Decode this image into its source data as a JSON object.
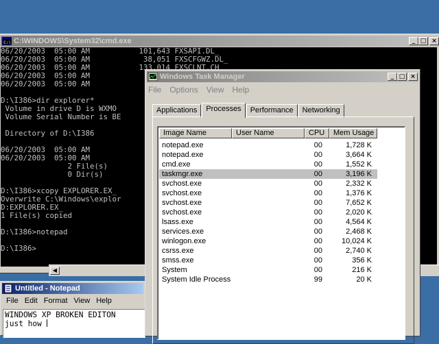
{
  "cmd": {
    "title": "C:\\WINDOWS\\System32\\cmd.exe",
    "lines": [
      "06/20/2003  05:00 AM           101,643 FXSAPI.DL_",
      "06/20/2003  05:00 AM            38,051 FXSCFGWZ.DL_",
      "06/20/2003  05:00 AM           133,014 FXSCLNT.CH_",
      "06/20/2003  05:00 AM",
      "06/20/2003  05:00 AM",
      "",
      "D:\\I386>dir explorer*",
      " Volume in drive D is WXMO",
      " Volume Serial Number is BE",
      "",
      " Directory of D:\\I386",
      "",
      "06/20/2003  05:00 AM",
      "06/20/2003  05:00 AM",
      "               2 File(s)",
      "               0 Dir(s)",
      "",
      "D:\\I386>xcopy EXPLORER.EX_",
      "Overwrite C:\\Windows\\explor",
      "D:EXPLORER.EX_",
      "1 File(s) copied",
      "",
      "D:\\I386>notepad",
      "",
      "D:\\I386>"
    ]
  },
  "taskmgr": {
    "title": "Windows Task Manager",
    "menu": [
      "File",
      "Options",
      "View",
      "Help"
    ],
    "tabs": [
      "Applications",
      "Processes",
      "Performance",
      "Networking"
    ],
    "selected_tab": "Processes",
    "columns": [
      "Image Name",
      "User Name",
      "CPU",
      "Mem Usage"
    ],
    "processes": [
      {
        "name": "notepad.exe",
        "cpu": "00",
        "mem": "1,728 K"
      },
      {
        "name": "notepad.exe",
        "cpu": "00",
        "mem": "3,664 K"
      },
      {
        "name": "cmd.exe",
        "cpu": "00",
        "mem": "1,552 K"
      },
      {
        "name": "taskmgr.exe",
        "cpu": "00",
        "mem": "3,196 K"
      },
      {
        "name": "svchost.exe",
        "cpu": "00",
        "mem": "2,332 K"
      },
      {
        "name": "svchost.exe",
        "cpu": "00",
        "mem": "1,376 K"
      },
      {
        "name": "svchost.exe",
        "cpu": "00",
        "mem": "7,652 K"
      },
      {
        "name": "svchost.exe",
        "cpu": "00",
        "mem": "2,020 K"
      },
      {
        "name": "lsass.exe",
        "cpu": "00",
        "mem": "4,564 K"
      },
      {
        "name": "services.exe",
        "cpu": "00",
        "mem": "2,468 K"
      },
      {
        "name": "winlogon.exe",
        "cpu": "00",
        "mem": "10,024 K"
      },
      {
        "name": "csrss.exe",
        "cpu": "00",
        "mem": "2,740 K"
      },
      {
        "name": "smss.exe",
        "cpu": "00",
        "mem": "356 K"
      },
      {
        "name": "System",
        "cpu": "00",
        "mem": "216 K"
      },
      {
        "name": "System Idle Process",
        "cpu": "99",
        "mem": "20 K"
      }
    ],
    "selected_process": "taskmgr.exe"
  },
  "notepad": {
    "title": "Untitled - Notepad",
    "menu": [
      "File",
      "Edit",
      "Format",
      "View",
      "Help"
    ],
    "text_lines": [
      "WINDOWS XP BROKEN EDITON",
      "just how "
    ]
  },
  "colors": {
    "desktop": "#3a6ea5",
    "active_title": "#0a246a",
    "inactive_title": "#808080",
    "face": "#d4d0c8"
  }
}
